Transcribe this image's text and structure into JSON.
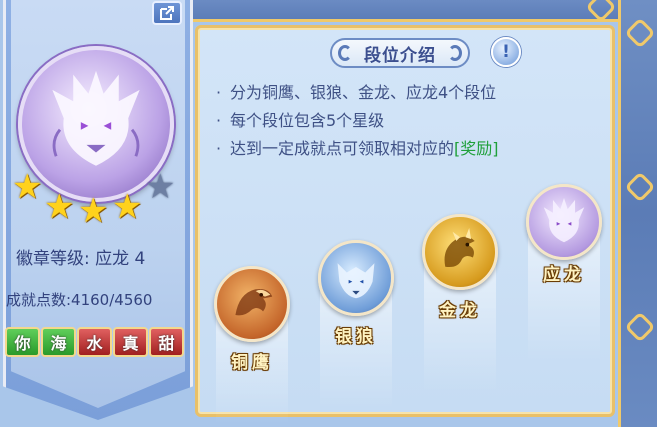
{
  "badge": {
    "level_label": "徽章等级: 应龙 4",
    "points_label": "成就点数:4160/4560",
    "stars_filled": 4,
    "stars_total": 5,
    "tags": [
      {
        "text": "你",
        "color": "green"
      },
      {
        "text": "海",
        "color": "green"
      },
      {
        "text": "水",
        "color": "red"
      },
      {
        "text": "真",
        "color": "red"
      },
      {
        "text": "甜",
        "color": "red"
      }
    ]
  },
  "panel": {
    "title": "段位介绍",
    "info_icon": "!",
    "bullets": [
      {
        "text": "分为铜鹰、银狼、金龙、应龙4个段位",
        "highlight": ""
      },
      {
        "text": "每个段位包含5个星级",
        "highlight": ""
      },
      {
        "text": "达到一定成就点可领取相对应的",
        "highlight": "[奖励]"
      }
    ]
  },
  "ranks": [
    {
      "name": "铜鹰",
      "icon": "eagle-icon",
      "color": "#c4652a"
    },
    {
      "name": "银狼",
      "icon": "wolf-icon",
      "color": "#6f9dd8"
    },
    {
      "name": "金龙",
      "icon": "gold-dragon-icon",
      "color": "#d69a1d"
    },
    {
      "name": "应龙",
      "icon": "purple-dragon-icon",
      "color": "#b49ae0"
    }
  ],
  "colors": {
    "reward_green": "#1fa03a",
    "text_blue": "#3f5185",
    "frame_gold": "#e9c068"
  }
}
